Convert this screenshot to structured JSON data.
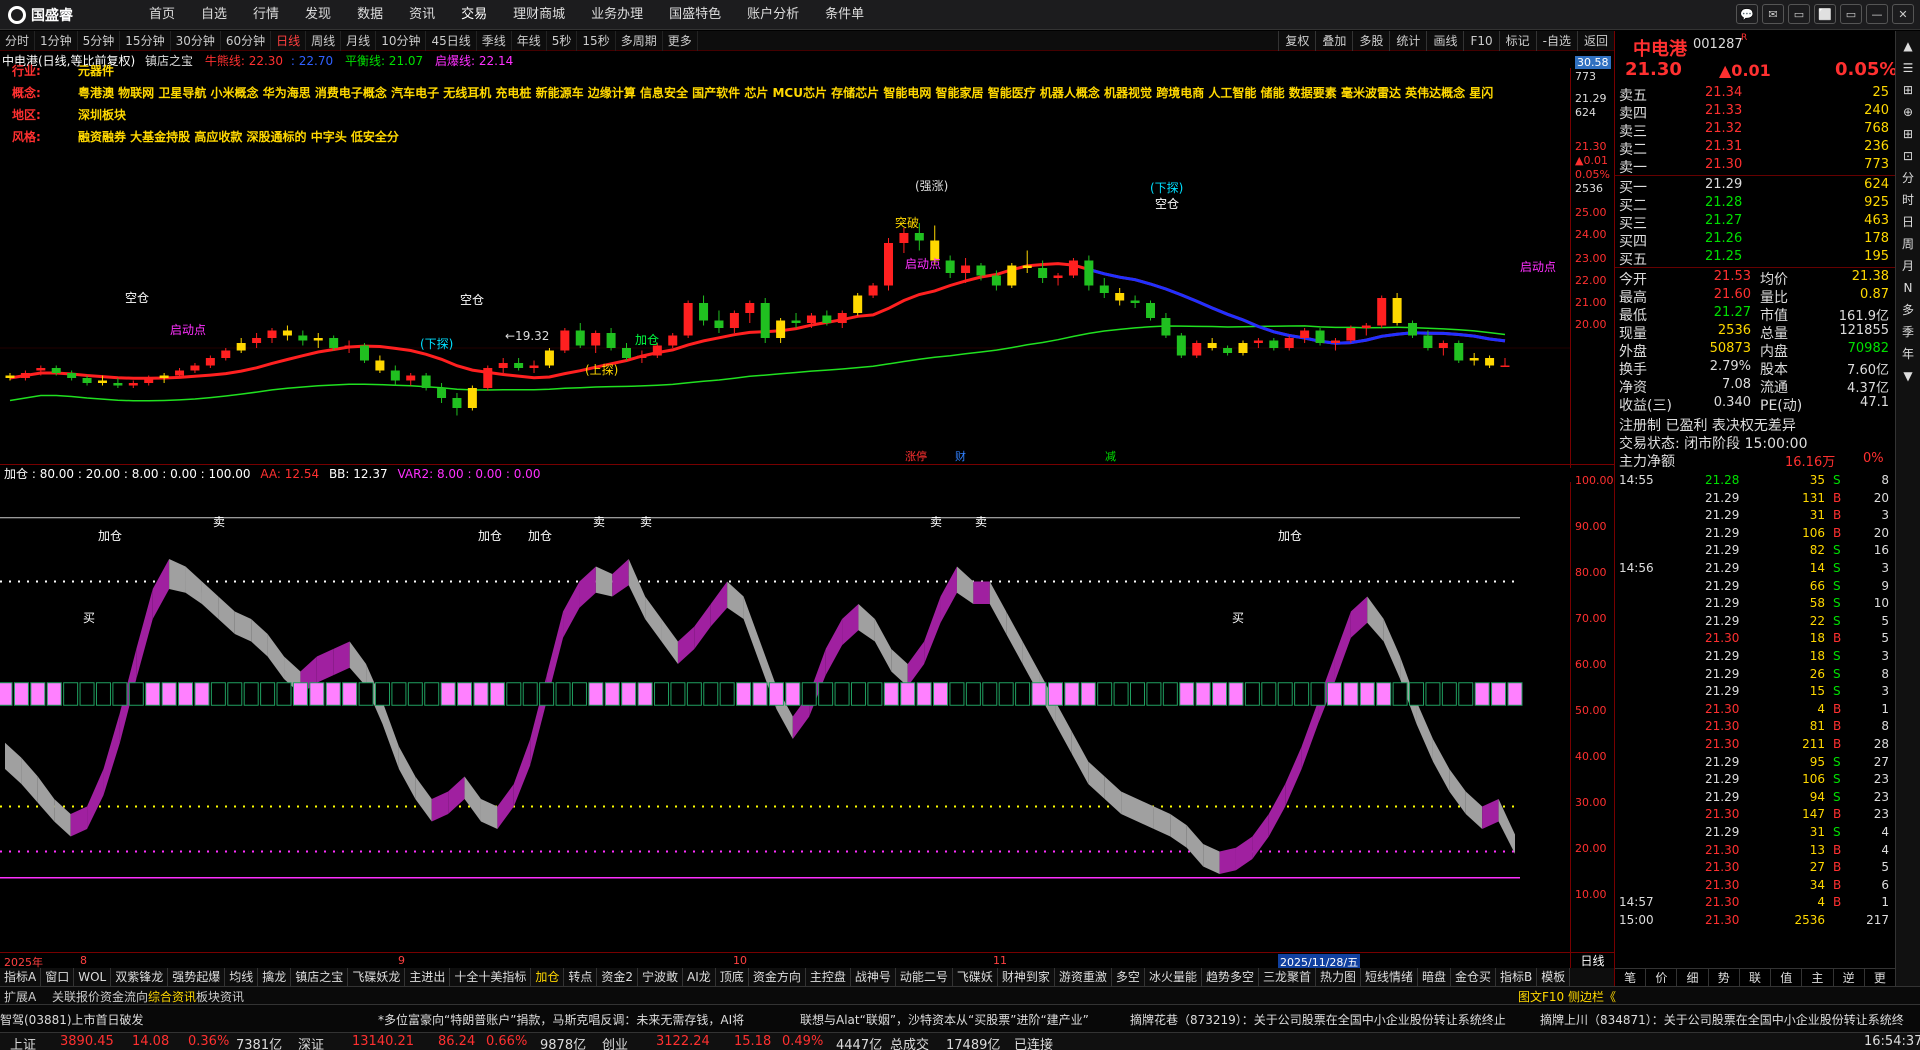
{
  "app": {
    "logo_text": "国盛睿"
  },
  "nav": [
    "首页",
    "自选",
    "行情",
    "发现",
    "数据",
    "资讯",
    "交易",
    "理财商城",
    "业务办理",
    "国盛特色",
    "账户分析",
    "条件单"
  ],
  "window_controls": [
    "💬",
    "✉",
    "▭",
    "⬜",
    "▭",
    "—",
    "✕"
  ],
  "periods": [
    "分时",
    "1分钟",
    "5分钟",
    "15分钟",
    "30分钟",
    "60分钟",
    "日线",
    "周线",
    "月线",
    "10分钟",
    "45日线",
    "季线",
    "年线",
    "5秒",
    "15秒",
    "多周期",
    "更多"
  ],
  "active_period": "日线",
  "tools": [
    "复权",
    "叠加",
    "多股",
    "统计",
    "画线",
    "F10",
    "标记",
    "-自选",
    "返回"
  ],
  "chart_title": {
    "name": "中电港(日线,等比前复权)",
    "indicator": "镇店之宝",
    "l1": "牛熊线: 22.30",
    "l2": ": 22.70",
    "l3": "平衡线: 21.07",
    "l4": "启爆线: 22.14"
  },
  "info": [
    {
      "label": "行业:",
      "value": "元器件"
    },
    {
      "label": "概念:",
      "value": "粤港澳 物联网 卫星导航 小米概念 华为海思 消费电子概念 汽车电子 无线耳机 充电桩 新能源车 边缘计算 信息安全 国产软件 芯片 MCU芯片 存储芯片 智能电网 智能家居 智能医疗 机器人概念 机器视觉 跨境电商 人工智能 储能 数据要素 毫米波雷达 英伟达概念 星闪"
    },
    {
      "label": "地区:",
      "value": "深圳板块"
    },
    {
      "label": "风格:",
      "value": "融资融券 大基金持股 高应收款 深股通标的 中字头 低安全分"
    }
  ],
  "price_axis": [
    "30.58",
    "773",
    "21.29",
    "624",
    "21.30",
    "▲0.01",
    "0.05%",
    "2536",
    "25.00",
    "24.00",
    "23.00",
    "22.00",
    "21.00",
    "20.00"
  ],
  "chart_annotations": {
    "low": "←19.32",
    "events": [
      "涨停",
      "财",
      "减"
    ],
    "marks": [
      "(下探)",
      "(上探)",
      "(下探)",
      "空仓",
      "空仓",
      "空仓",
      "突破",
      "启动点",
      "启动点",
      "启动点",
      "加仓",
      "(强涨)"
    ]
  },
  "osc_header": {
    "name": "加仓",
    "v": ": 80.00 : 20.00 : 8.00 : 0.00 : 100.00",
    "aa": "AA: 12.54",
    "bb": "BB: 12.37",
    "var2": "VAR2: 8.00 : 0.00 : 0.00"
  },
  "osc_axis": [
    "100.00",
    "90.00",
    "80.00",
    "70.00",
    "60.00",
    "50.00",
    "40.00",
    "30.00",
    "20.00",
    "10.00"
  ],
  "osc_labels": [
    "加仓",
    "加仓",
    "加仓",
    "加仓",
    "卖",
    "卖",
    "卖",
    "卖",
    "卖",
    "买",
    "买"
  ],
  "dates": [
    "2025年",
    "8",
    "9",
    "10",
    "11",
    "2025/11/28/五"
  ],
  "period_label": "日线",
  "bottom_tabs": [
    "指标A",
    "窗口",
    "WOL",
    "双紫锋龙",
    "强势起爆",
    "均线",
    "擒龙",
    "镇店之宝",
    "飞碟妖龙",
    "主进出",
    "十全十美指标",
    "加仓",
    "转点",
    "资金2",
    "宁波敢",
    "AI龙",
    "顶底",
    "资金方向",
    "主控盘",
    "战神号",
    "动能二号",
    "飞碟妖",
    "财神到家",
    "游资重激",
    "多空",
    "冰火量能",
    "趋势多空",
    "三龙聚首",
    "热力图",
    "短线情绪",
    "暗盘",
    "金仓买",
    "指标B",
    "模板"
  ],
  "sub_tabs": [
    "扩展A",
    "关联报价",
    "资金流向",
    "综合资讯",
    "板块资讯"
  ],
  "sub_right": "图文F10 侧边栏《",
  "ticker": [
    "智驾(03881)上市首日破发",
    "*多位富豪向“特朗普账户”捐款，马斯克唱反调：未来无需存钱，AI将",
    "联想与Alat“联姻”，沙特资本从“买股票”进阶“建产业”",
    "摘牌花巷（873219）：关于公司股票在全国中小企业股份转让系统终止",
    "摘牌上川（834871）：关于公司股票在全国中小企业股份转让系统终"
  ],
  "status": {
    "sh_label": "上证",
    "sh": "3890.45",
    "sh_chg": "14.08",
    "sh_pct": "0.36%",
    "sh_amt": "7381亿",
    "sz_label": "深证",
    "sz": "13140.21",
    "sz_chg": "86.24",
    "sz_pct": "0.66%",
    "sz_amt": "9878亿",
    "cy_label": "创业",
    "cy": "3122.24",
    "cy_chg": "15.18",
    "cy_pct": "0.49%",
    "cy_amt": "4447亿",
    "total_label": "总成交",
    "total": "17489亿",
    "conn": "已连接",
    "time": "16:54:37"
  },
  "quote": {
    "name": "中电港",
    "code": "001287",
    "badge": "R",
    "price": "21.30",
    "chg": "▲0.01",
    "pct": "0.05%",
    "asks": [
      [
        "卖五",
        "21.34",
        "25"
      ],
      [
        "卖四",
        "21.33",
        "240"
      ],
      [
        "卖三",
        "21.32",
        "768"
      ],
      [
        "卖二",
        "21.31",
        "236"
      ],
      [
        "卖一",
        "21.30",
        "773"
      ]
    ],
    "bids": [
      [
        "买一",
        "21.29",
        "624"
      ],
      [
        "买二",
        "21.28",
        "925"
      ],
      [
        "买三",
        "21.27",
        "463"
      ],
      [
        "买四",
        "21.26",
        "178"
      ],
      [
        "买五",
        "21.25",
        "195"
      ]
    ],
    "stats": [
      [
        "今开",
        "21.53",
        "均价",
        "21.38"
      ],
      [
        "最高",
        "21.60",
        "量比",
        "0.87"
      ],
      [
        "最低",
        "21.27",
        "市值",
        "161.9亿"
      ],
      [
        "现量",
        "2536",
        "总量",
        "121855"
      ],
      [
        "外盘",
        "50873",
        "内盘",
        "70982"
      ],
      [
        "换手",
        "2.79%",
        "股本",
        "7.60亿"
      ],
      [
        "净资",
        "7.08",
        "流通",
        "4.37亿"
      ],
      [
        "收益(三)",
        "0.340",
        "PE(动)",
        "47.1"
      ]
    ],
    "notes": [
      "注册制 已盈利 表决权无差异",
      "交易状态: 闭市阶段 15:00:00"
    ],
    "flow_label": "主力净额",
    "flow_val": "16.16万",
    "flow_pct": "0%"
  },
  "ticks": [
    [
      "14:55",
      "21.28",
      "35",
      "S",
      "8"
    ],
    [
      "",
      "21.29",
      "131",
      "B",
      "20"
    ],
    [
      "",
      "21.29",
      "31",
      "B",
      "3"
    ],
    [
      "",
      "21.29",
      "106",
      "B",
      "20"
    ],
    [
      "",
      "21.29",
      "82",
      "S",
      "16"
    ],
    [
      "14:56",
      "21.29",
      "14",
      "S",
      "3"
    ],
    [
      "",
      "21.29",
      "66",
      "S",
      "9"
    ],
    [
      "",
      "21.29",
      "58",
      "S",
      "10"
    ],
    [
      "",
      "21.29",
      "22",
      "S",
      "5"
    ],
    [
      "",
      "21.30",
      "18",
      "B",
      "5"
    ],
    [
      "",
      "21.29",
      "18",
      "S",
      "3"
    ],
    [
      "",
      "21.29",
      "26",
      "S",
      "8"
    ],
    [
      "",
      "21.29",
      "15",
      "S",
      "3"
    ],
    [
      "",
      "21.30",
      "4",
      "B",
      "1"
    ],
    [
      "",
      "21.30",
      "81",
      "B",
      "8"
    ],
    [
      "",
      "21.30",
      "211",
      "B",
      "28"
    ],
    [
      "",
      "21.29",
      "95",
      "S",
      "27"
    ],
    [
      "",
      "21.29",
      "106",
      "S",
      "23"
    ],
    [
      "",
      "21.29",
      "94",
      "S",
      "23"
    ],
    [
      "",
      "21.30",
      "147",
      "B",
      "23"
    ],
    [
      "",
      "21.29",
      "31",
      "S",
      "4"
    ],
    [
      "",
      "21.30",
      "13",
      "B",
      "4"
    ],
    [
      "",
      "21.30",
      "27",
      "B",
      "5"
    ],
    [
      "",
      "21.30",
      "34",
      "B",
      "6"
    ],
    [
      "14:57",
      "21.30",
      "4",
      "B",
      "1"
    ],
    [
      "15:00",
      "21.30",
      "2536",
      "",
      "217"
    ]
  ],
  "rp_tabs": [
    "笔",
    "价",
    "细",
    "势",
    "联",
    "值",
    "主",
    "逆",
    "更"
  ],
  "side_tabs": [
    "▲",
    "☰",
    "⊞",
    "⊕",
    "⊞",
    "⊡",
    "分",
    "时",
    "日",
    "周",
    "月",
    "N",
    "多",
    "季",
    "年",
    "▼"
  ],
  "chart_data": [
    {
      "type": "candlestick",
      "title": "中电港(日线,等比前复权)",
      "ylim": [
        19,
        27
      ],
      "ohlc": [
        [
          20.9,
          21.0,
          20.7,
          20.8
        ],
        [
          20.8,
          21.1,
          20.7,
          21.0
        ],
        [
          21.1,
          21.3,
          20.9,
          21.2
        ],
        [
          21.2,
          21.3,
          20.9,
          21.0
        ],
        [
          21.0,
          21.1,
          20.7,
          20.8
        ],
        [
          20.8,
          20.9,
          20.5,
          20.6
        ],
        [
          20.7,
          20.9,
          20.5,
          20.6
        ],
        [
          20.6,
          20.8,
          20.4,
          20.5
        ],
        [
          20.5,
          20.7,
          20.4,
          20.6
        ],
        [
          20.6,
          20.9,
          20.5,
          20.8
        ],
        [
          20.8,
          21.0,
          20.6,
          20.9
        ],
        [
          20.9,
          21.2,
          20.8,
          21.1
        ],
        [
          21.1,
          21.4,
          21.0,
          21.3
        ],
        [
          21.3,
          21.7,
          21.2,
          21.6
        ],
        [
          21.6,
          22.0,
          21.5,
          21.9
        ],
        [
          21.9,
          22.4,
          21.8,
          22.2
        ],
        [
          22.2,
          22.6,
          22.0,
          22.4
        ],
        [
          22.4,
          22.8,
          22.2,
          22.7
        ],
        [
          22.7,
          22.9,
          22.3,
          22.5
        ],
        [
          22.5,
          22.7,
          22.1,
          22.3
        ],
        [
          22.3,
          22.6,
          22.0,
          22.4
        ],
        [
          22.4,
          22.5,
          21.9,
          22.0
        ],
        [
          22.0,
          22.3,
          21.8,
          22.1
        ],
        [
          22.1,
          22.2,
          21.4,
          21.5
        ],
        [
          21.5,
          21.7,
          21.0,
          21.1
        ],
        [
          21.1,
          21.3,
          20.5,
          20.7
        ],
        [
          20.7,
          21.0,
          20.5,
          20.9
        ],
        [
          20.9,
          21.0,
          20.3,
          20.4
        ],
        [
          20.4,
          20.6,
          19.8,
          20.0
        ],
        [
          20.0,
          20.2,
          19.3,
          19.6
        ],
        [
          19.6,
          20.5,
          19.5,
          20.4
        ],
        [
          20.4,
          21.3,
          20.3,
          21.2
        ],
        [
          21.2,
          21.6,
          21.0,
          21.4
        ],
        [
          21.4,
          21.6,
          21.1,
          21.2
        ],
        [
          21.2,
          21.5,
          21.0,
          21.3
        ],
        [
          21.3,
          22.0,
          21.2,
          21.9
        ],
        [
          21.9,
          22.8,
          21.8,
          22.7
        ],
        [
          22.7,
          23.0,
          22.0,
          22.1
        ],
        [
          22.1,
          22.7,
          21.8,
          22.6
        ],
        [
          22.6,
          22.8,
          21.9,
          22.0
        ],
        [
          22.0,
          22.2,
          21.5,
          21.6
        ],
        [
          21.6,
          21.9,
          21.4,
          21.7
        ],
        [
          21.7,
          22.2,
          21.6,
          22.1
        ],
        [
          22.1,
          22.6,
          22.0,
          22.5
        ],
        [
          22.5,
          23.9,
          22.4,
          23.8
        ],
        [
          23.8,
          24.1,
          22.9,
          23.1
        ],
        [
          23.1,
          23.5,
          22.6,
          22.8
        ],
        [
          22.8,
          23.5,
          22.6,
          23.4
        ],
        [
          23.4,
          23.9,
          23.0,
          23.8
        ],
        [
          23.8,
          24.0,
          22.2,
          22.4
        ],
        [
          22.4,
          23.2,
          22.2,
          23.1
        ],
        [
          23.1,
          23.4,
          22.8,
          23.0
        ],
        [
          23.0,
          23.4,
          22.8,
          23.3
        ],
        [
          23.3,
          23.5,
          22.9,
          23.0
        ],
        [
          23.0,
          23.5,
          22.8,
          23.4
        ],
        [
          23.4,
          24.2,
          23.3,
          24.1
        ],
        [
          24.1,
          24.6,
          24.0,
          24.5
        ],
        [
          24.5,
          26.4,
          24.3,
          26.2
        ],
        [
          26.2,
          26.8,
          25.8,
          26.6
        ],
        [
          26.6,
          27.0,
          25.9,
          26.3
        ],
        [
          26.3,
          26.9,
          25.3,
          25.5
        ],
        [
          25.5,
          25.7,
          24.8,
          25.0
        ],
        [
          25.0,
          25.6,
          24.6,
          25.3
        ],
        [
          25.3,
          25.4,
          24.7,
          24.9
        ],
        [
          24.9,
          25.1,
          24.3,
          24.5
        ],
        [
          24.5,
          25.4,
          24.4,
          25.3
        ],
        [
          25.3,
          25.9,
          25.0,
          25.2
        ],
        [
          25.2,
          25.5,
          24.6,
          24.8
        ],
        [
          24.8,
          25.0,
          24.5,
          24.9
        ],
        [
          24.9,
          25.6,
          24.8,
          25.5
        ],
        [
          25.5,
          25.7,
          24.3,
          24.5
        ],
        [
          24.5,
          24.8,
          24.0,
          24.2
        ],
        [
          24.2,
          24.4,
          23.7,
          23.9
        ],
        [
          23.9,
          24.1,
          23.6,
          23.8
        ],
        [
          23.8,
          23.9,
          23.1,
          23.2
        ],
        [
          23.2,
          23.4,
          22.4,
          22.5
        ],
        [
          22.5,
          22.6,
          21.6,
          21.7
        ],
        [
          21.7,
          22.3,
          21.6,
          22.2
        ],
        [
          22.2,
          22.4,
          21.9,
          22.0
        ],
        [
          22.0,
          22.1,
          21.7,
          21.8
        ],
        [
          21.8,
          22.3,
          21.7,
          22.2
        ],
        [
          22.2,
          22.4,
          22.0,
          22.3
        ],
        [
          22.3,
          22.4,
          21.9,
          22.0
        ],
        [
          22.0,
          22.5,
          21.9,
          22.4
        ],
        [
          22.4,
          22.8,
          22.2,
          22.7
        ],
        [
          22.7,
          22.8,
          22.1,
          22.2
        ],
        [
          22.2,
          22.4,
          21.9,
          22.3
        ],
        [
          22.3,
          22.9,
          22.2,
          22.8
        ],
        [
          22.8,
          23.0,
          22.5,
          22.9
        ],
        [
          22.9,
          24.1,
          22.8,
          24.0
        ],
        [
          24.0,
          24.2,
          22.9,
          23.0
        ],
        [
          23.0,
          23.1,
          22.4,
          22.5
        ],
        [
          22.5,
          22.7,
          21.9,
          22.0
        ],
        [
          22.0,
          22.3,
          21.7,
          22.2
        ],
        [
          22.2,
          22.3,
          21.4,
          21.5
        ],
        [
          21.5,
          21.8,
          21.3,
          21.6
        ],
        [
          21.6,
          21.7,
          21.2,
          21.3
        ],
        [
          21.3,
          21.6,
          21.27,
          21.3
        ]
      ]
    },
    {
      "type": "line",
      "title": "加仓",
      "ylim": [
        0,
        100
      ],
      "series": [
        {
          "name": "AA",
          "values": [
            37,
            33,
            28,
            22,
            18,
            20,
            30,
            45,
            62,
            78,
            86,
            84,
            80,
            76,
            72,
            70,
            66,
            60,
            56,
            60,
            62,
            64,
            58,
            48,
            36,
            28,
            22,
            24,
            28,
            22,
            20,
            26,
            38,
            55,
            72,
            80,
            84,
            82,
            86,
            76,
            70,
            64,
            68,
            74,
            80,
            76,
            64,
            52,
            44,
            50,
            62,
            70,
            74,
            70,
            62,
            58,
            64,
            76,
            84,
            80,
            80,
            72,
            64,
            56,
            48,
            40,
            32,
            28,
            24,
            22,
            20,
            18,
            15,
            10,
            8,
            9,
            12,
            18,
            26,
            36,
            48,
            60,
            72,
            76,
            70,
            60,
            48,
            38,
            30,
            24,
            20,
            22,
            12.54
          ]
        },
        {
          "name": "BB",
          "values": [
            35,
            31,
            26,
            21,
            17,
            19,
            28,
            42,
            59,
            75,
            83,
            82,
            79,
            75,
            71,
            69,
            65,
            59,
            55,
            58,
            60,
            62,
            57,
            47,
            35,
            27,
            21,
            23,
            27,
            21,
            19,
            25,
            36,
            53,
            70,
            78,
            82,
            81,
            84,
            75,
            69,
            63,
            67,
            73,
            78,
            75,
            63,
            51,
            43,
            49,
            60,
            68,
            72,
            69,
            61,
            57,
            63,
            74,
            82,
            79,
            79,
            71,
            63,
            55,
            47,
            39,
            31,
            27,
            23,
            21,
            19,
            17,
            14,
            9,
            7,
            8,
            11,
            17,
            25,
            35,
            47,
            58,
            70,
            74,
            69,
            59,
            47,
            37,
            29,
            23,
            19,
            21,
            12.37
          ]
        }
      ]
    }
  ]
}
